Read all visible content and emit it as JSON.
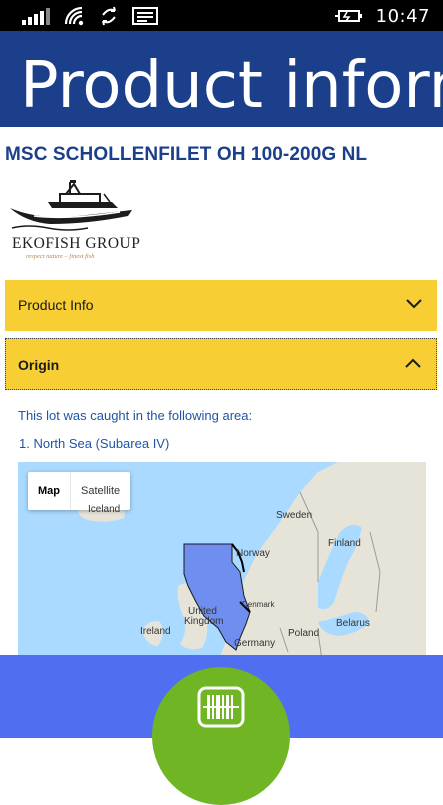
{
  "status_bar": {
    "icons": [
      "signal-icon",
      "wifi-icon",
      "data-sense-icon",
      "message-icon",
      "battery-charging-icon"
    ],
    "time": "10:47"
  },
  "header": {
    "title": "Product inform"
  },
  "product": {
    "name": "MSC SCHOLLENFILET OH 100-200G NL"
  },
  "logo": {
    "name": "EKOFISH GROUP",
    "tagline": "respect nature – finest fish"
  },
  "accordions": [
    {
      "label": "Product Info",
      "expanded": false
    },
    {
      "label": "Origin",
      "expanded": true
    }
  ],
  "origin": {
    "intro": "This lot was caught in the following area:",
    "areas": [
      "1.  North Sea (Subarea IV)"
    ]
  },
  "map": {
    "types": [
      "Map",
      "Satellite"
    ],
    "selected_type": "Map",
    "labels": {
      "sweden": "Sweden",
      "norway": "Norway",
      "finland": "Finland",
      "denmark": "Denmark",
      "united": "United",
      "kingdom": "Kingdom",
      "ireland": "Ireland",
      "poland": "Poland",
      "belarus": "Belarus",
      "germany": "Germany",
      "iceland": "Iceland"
    },
    "colors": {
      "sea": "#aadaff",
      "land": "#e6e4d9",
      "highlight": "#6f8ff0"
    }
  },
  "footer": {
    "scan_icon": "barcode-scan-icon",
    "colors": {
      "bar": "#4f6ef0",
      "button": "#6fb524"
    }
  },
  "colors": {
    "header": "#1b3f8b",
    "accordion": "#f7cf35",
    "link_text": "#1e56a3"
  }
}
